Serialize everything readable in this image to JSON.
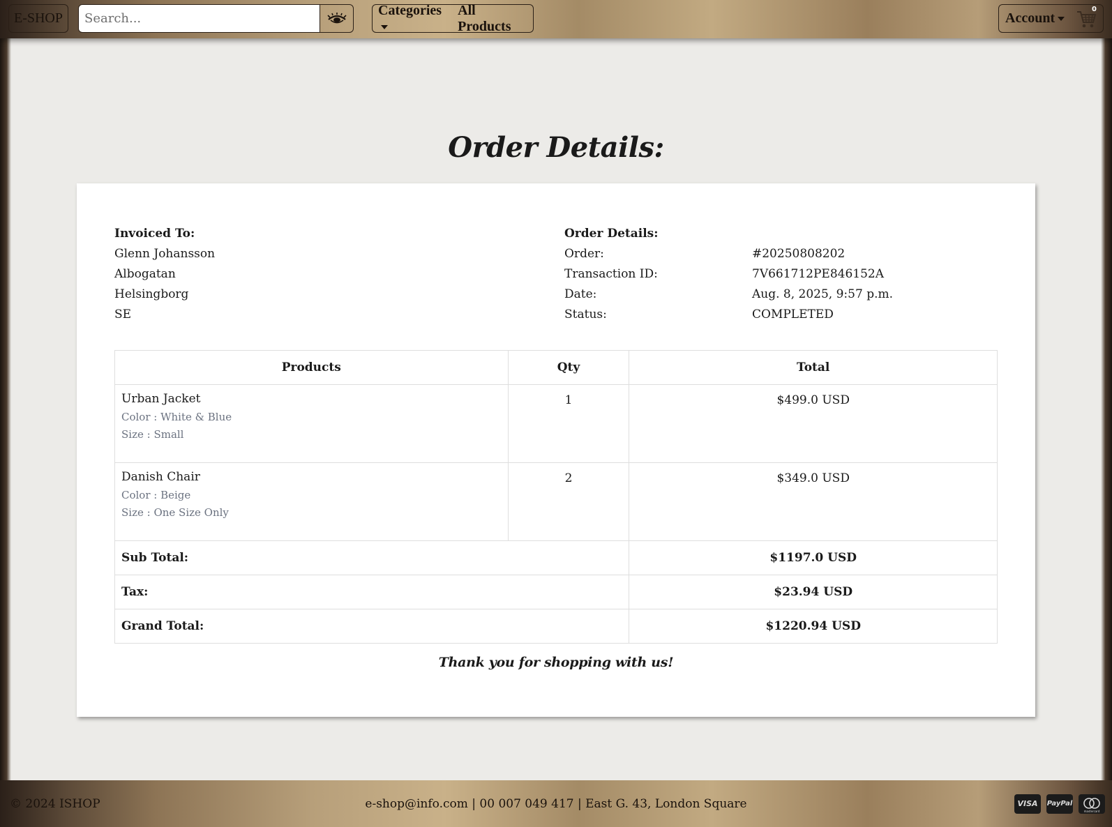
{
  "header": {
    "logo": "E-SHOP",
    "search_placeholder": "Search...",
    "search_icon": "eye-icon",
    "nav": {
      "categories": "Categories",
      "all_products": "All Products"
    },
    "account": "Account",
    "cart_count": "0"
  },
  "page_title": "Order Details:",
  "invoiced": {
    "heading": "Invoiced To:",
    "name": "Glenn Johansson",
    "street": "Albogatan",
    "city": "Helsingborg",
    "country": "SE"
  },
  "order": {
    "heading": "Order Details:",
    "rows": [
      {
        "label": "Order:",
        "value": "#20250808202"
      },
      {
        "label": "Transaction ID:",
        "value": "7V661712PE846152A"
      },
      {
        "label": "Date:",
        "value": "Aug. 8, 2025, 9:57 p.m."
      },
      {
        "label": "Status:",
        "value": "COMPLETED"
      }
    ]
  },
  "table": {
    "headers": {
      "products": "Products",
      "qty": "Qty",
      "total": "Total"
    },
    "items": [
      {
        "name": "Urban Jacket",
        "color": "Color : White & Blue",
        "size": "Size : Small",
        "qty": "1",
        "total": "$499.0 USD"
      },
      {
        "name": "Danish Chair",
        "color": "Color : Beige",
        "size": "Size : One Size Only",
        "qty": "2",
        "total": "$349.0 USD"
      }
    ],
    "summary": {
      "subtotal_label": "Sub Total:",
      "subtotal": "$1197.0 USD",
      "tax_label": "Tax:",
      "tax": "$23.94 USD",
      "grand_label": "Grand Total:",
      "grand": "$1220.94 USD"
    }
  },
  "thanks": "Thank you for shopping with us!",
  "footer": {
    "copyright": "© 2024 ISHOP",
    "contact": "e-shop@info.com | 00 007 049 417 | East G. 43, London Square",
    "payment": {
      "visa": "VISA",
      "paypal": "PayPal",
      "mastercard": "mastercard"
    }
  },
  "colors": {
    "frame_brown": "#8d7455",
    "frame_gold": "#c9b189",
    "page_bg": "#ecebe8",
    "muted_text": "#6b7280"
  }
}
